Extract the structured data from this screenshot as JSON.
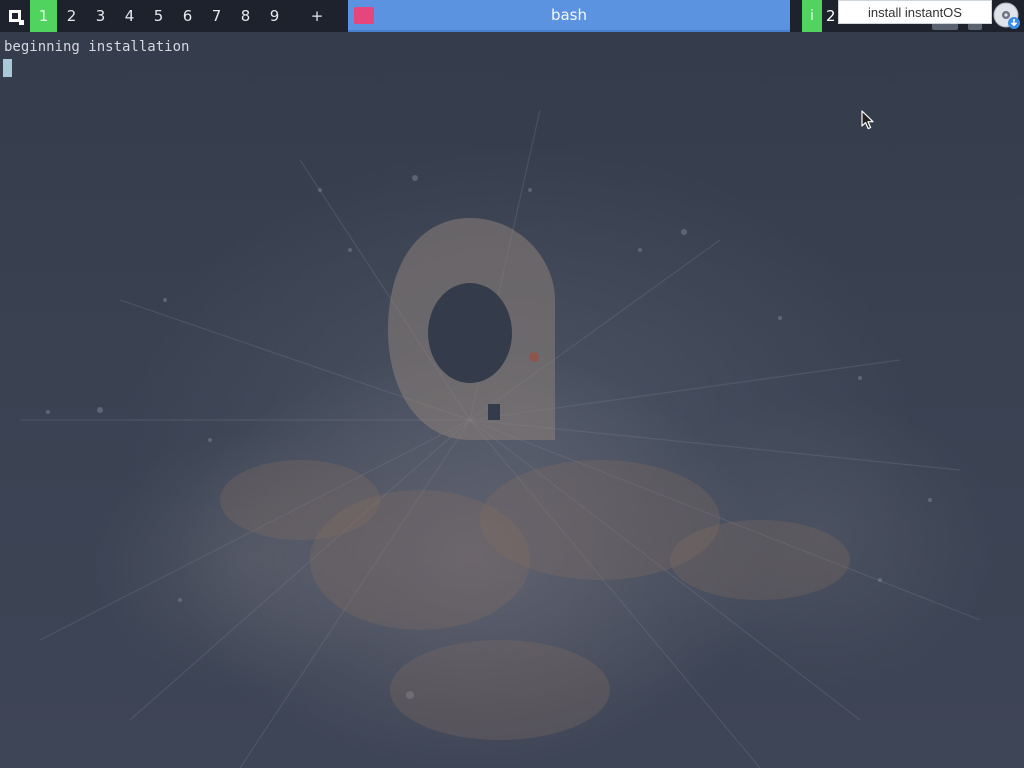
{
  "topbar": {
    "launcher_icon": "instantmenu-icon",
    "tags": [
      {
        "label": "1",
        "active": true
      },
      {
        "label": "2",
        "active": false
      },
      {
        "label": "3",
        "active": false
      },
      {
        "label": "4",
        "active": false
      },
      {
        "label": "5",
        "active": false
      },
      {
        "label": "6",
        "active": false
      },
      {
        "label": "7",
        "active": false
      },
      {
        "label": "8",
        "active": false
      },
      {
        "label": "9",
        "active": false
      }
    ],
    "add_tag_label": "+",
    "active_window": {
      "title": "bash",
      "icon": "terminal-icon"
    },
    "status": {
      "indicator_label": "i",
      "number": "2"
    },
    "tray_icon": "install-disc-icon",
    "tooltip": "install instantOS"
  },
  "terminal": {
    "output_line": "beginning installation"
  },
  "colors": {
    "bar_bg": "#1e222c",
    "accent_green": "#50d35f",
    "title_blue": "#5c93e0",
    "window_icon_pink": "#e5467e",
    "desktop_bg": "#333a49",
    "cursor_color": "#a9c9d9"
  }
}
